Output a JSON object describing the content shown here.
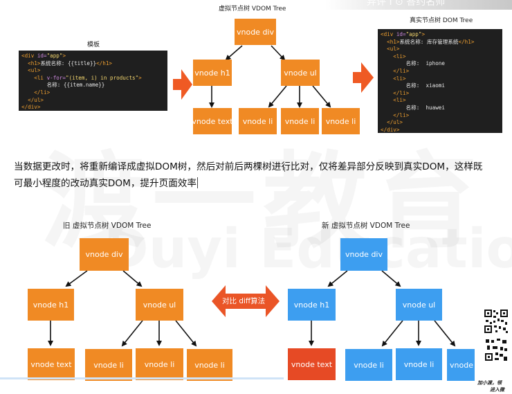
{
  "top": {
    "vdom_title": "虚拟节点树 VDOM Tree",
    "template_title": "模板",
    "real_dom_title": "真实节点树 DOM Tree",
    "top_cut_text": "弃评  Ι  ⊙ 答约名师"
  },
  "template_code": [
    {
      "parts": [
        [
          "tag",
          "<div "
        ],
        [
          "attr",
          "id="
        ],
        [
          "str",
          "\"app\""
        ],
        [
          "tag",
          ">"
        ]
      ]
    },
    {
      "parts": [
        [
          "tag",
          "  <h1>"
        ],
        [
          "txt",
          "系统名称: {{title}}"
        ],
        [
          "tag",
          "</h1>"
        ]
      ]
    },
    {
      "parts": [
        [
          "tag",
          "  <ul>"
        ]
      ]
    },
    {
      "parts": [
        [
          "tag",
          "    <li "
        ],
        [
          "attr",
          "v-for="
        ],
        [
          "str",
          "\"(item, i) in products\""
        ],
        [
          "tag",
          ">"
        ]
      ]
    },
    {
      "parts": [
        [
          "txt",
          "        名称: {{item.name}}"
        ]
      ]
    },
    {
      "parts": [
        [
          "tag",
          "    </li>"
        ]
      ]
    },
    {
      "parts": [
        [
          "tag",
          "  </ul>"
        ]
      ]
    },
    {
      "parts": [
        [
          "tag",
          "</div>"
        ]
      ]
    }
  ],
  "real_dom_code": [
    {
      "parts": [
        [
          "tag",
          "<div "
        ],
        [
          "attr",
          "id="
        ],
        [
          "str",
          "\"app\""
        ],
        [
          "tag",
          ">"
        ]
      ]
    },
    {
      "parts": [
        [
          "tag",
          "  <h1>"
        ],
        [
          "txt",
          "系统名称: 库存管理系统"
        ],
        [
          "tag",
          "</h1>"
        ]
      ]
    },
    {
      "parts": [
        [
          "tag",
          "  <ul>"
        ]
      ]
    },
    {
      "parts": [
        [
          "tag",
          "    <li>"
        ]
      ]
    },
    {
      "parts": [
        [
          "txt",
          "        名称:  iphone"
        ]
      ]
    },
    {
      "parts": [
        [
          "tag",
          "    </li>"
        ]
      ]
    },
    {
      "parts": [
        [
          "tag",
          "    <li>"
        ]
      ]
    },
    {
      "parts": [
        [
          "txt",
          "        名称:  xiaomi"
        ]
      ]
    },
    {
      "parts": [
        [
          "tag",
          "    </li>"
        ]
      ]
    },
    {
      "parts": [
        [
          "tag",
          "    <li>"
        ]
      ]
    },
    {
      "parts": [
        [
          "txt",
          "        名称:  huawei"
        ]
      ]
    },
    {
      "parts": [
        [
          "tag",
          "    </li>"
        ]
      ]
    },
    {
      "parts": [
        [
          "tag",
          "  </ul>"
        ]
      ]
    },
    {
      "parts": [
        [
          "tag",
          "</div>"
        ]
      ]
    }
  ],
  "nodes": {
    "div": "vnode div",
    "h1": "vnode h1",
    "ul": "vnode ul",
    "text": "vnode text",
    "li": "vnode li"
  },
  "paragraph": {
    "line1": "当数据更改时，将重新编译成虚拟DOM树，然后对前后两棵树进行比对，仅将差异部分反映到真实DOM，这样既",
    "line2": "可最小程度的改动真实DOM，提升页面效率"
  },
  "cursor_mark": "I",
  "old_tree_title": "旧 虚拟节点树 VDOM Tree",
  "new_tree_title": "新 虚拟节点树 VDOM Tree",
  "diff_label": "对比 diff算法",
  "watermark": {
    "cn": "渡一教育",
    "en": "Duyi Education"
  },
  "qr_caption": {
    "line1": "加小渡，领",
    "line2": "进入微"
  },
  "colors": {
    "orange": "#f08a24",
    "blue": "#3d9ef0",
    "red": "#e64a25",
    "code_bg": "#1f1f1f"
  }
}
